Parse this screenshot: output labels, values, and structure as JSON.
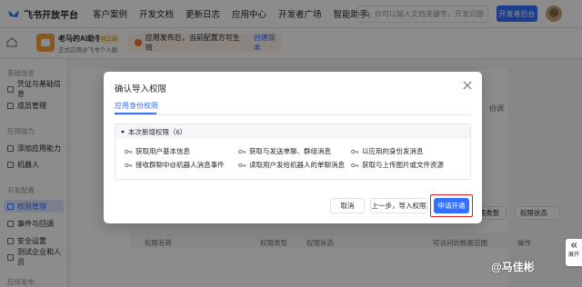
{
  "topnav": {
    "logo_text": "飞书开放平台",
    "links": [
      "客户案例",
      "开发文档",
      "更新日志",
      "应用中心",
      "开发者广场",
      "智能助手"
    ],
    "search_placeholder": "你可以输入文档关键字，开发问题",
    "dev_console_label": "开发者后台"
  },
  "appbar": {
    "app_name": "老马的AI助手",
    "app_tag": "待上线",
    "app_sub": "正式应用@飞书个人版",
    "notice_text": "应用发布后，当前配置方可生效",
    "notice_link": "创建版本"
  },
  "sidebar": {
    "groups": [
      "基础信息",
      "应用能力",
      "开发配置",
      "应用发布"
    ],
    "items": [
      "凭证与基础信息",
      "成员管理",
      "添加应用能力",
      "机器人",
      "权限管理",
      "事件与回调",
      "安全设置",
      "测试企业和人员"
    ],
    "active_index": 4
  },
  "background": {
    "right_text_1": "请",
    "right_text_2": "份调",
    "filter_1": "权限类型",
    "filter_2": "权限状态",
    "table_headers": [
      "权限名称",
      "权限类型",
      "权限状态",
      "可访问的数据范围",
      "操作"
    ]
  },
  "modal": {
    "title": "确认导入权限",
    "tab": "应用身份权限",
    "section_header": "本次新增权限（6）",
    "permissions": [
      "获取用户基本信息",
      "获取与发送单聊、群组消息",
      "以应用的身份发消息",
      "接收群聊中@机器人消息事件",
      "读取用户发给机器人的单聊消息",
      "获取与上传图片或文件资源"
    ],
    "buttons": {
      "cancel": "取消",
      "prev_import": "上一步，导入权限",
      "apply": "申请开通"
    }
  },
  "float_tab": {
    "label": "展开"
  },
  "watermark": "@马佳彬",
  "colors": {
    "primary": "#3370ff",
    "highlight": "#e02020",
    "notice_bg": "#fff1e6"
  }
}
